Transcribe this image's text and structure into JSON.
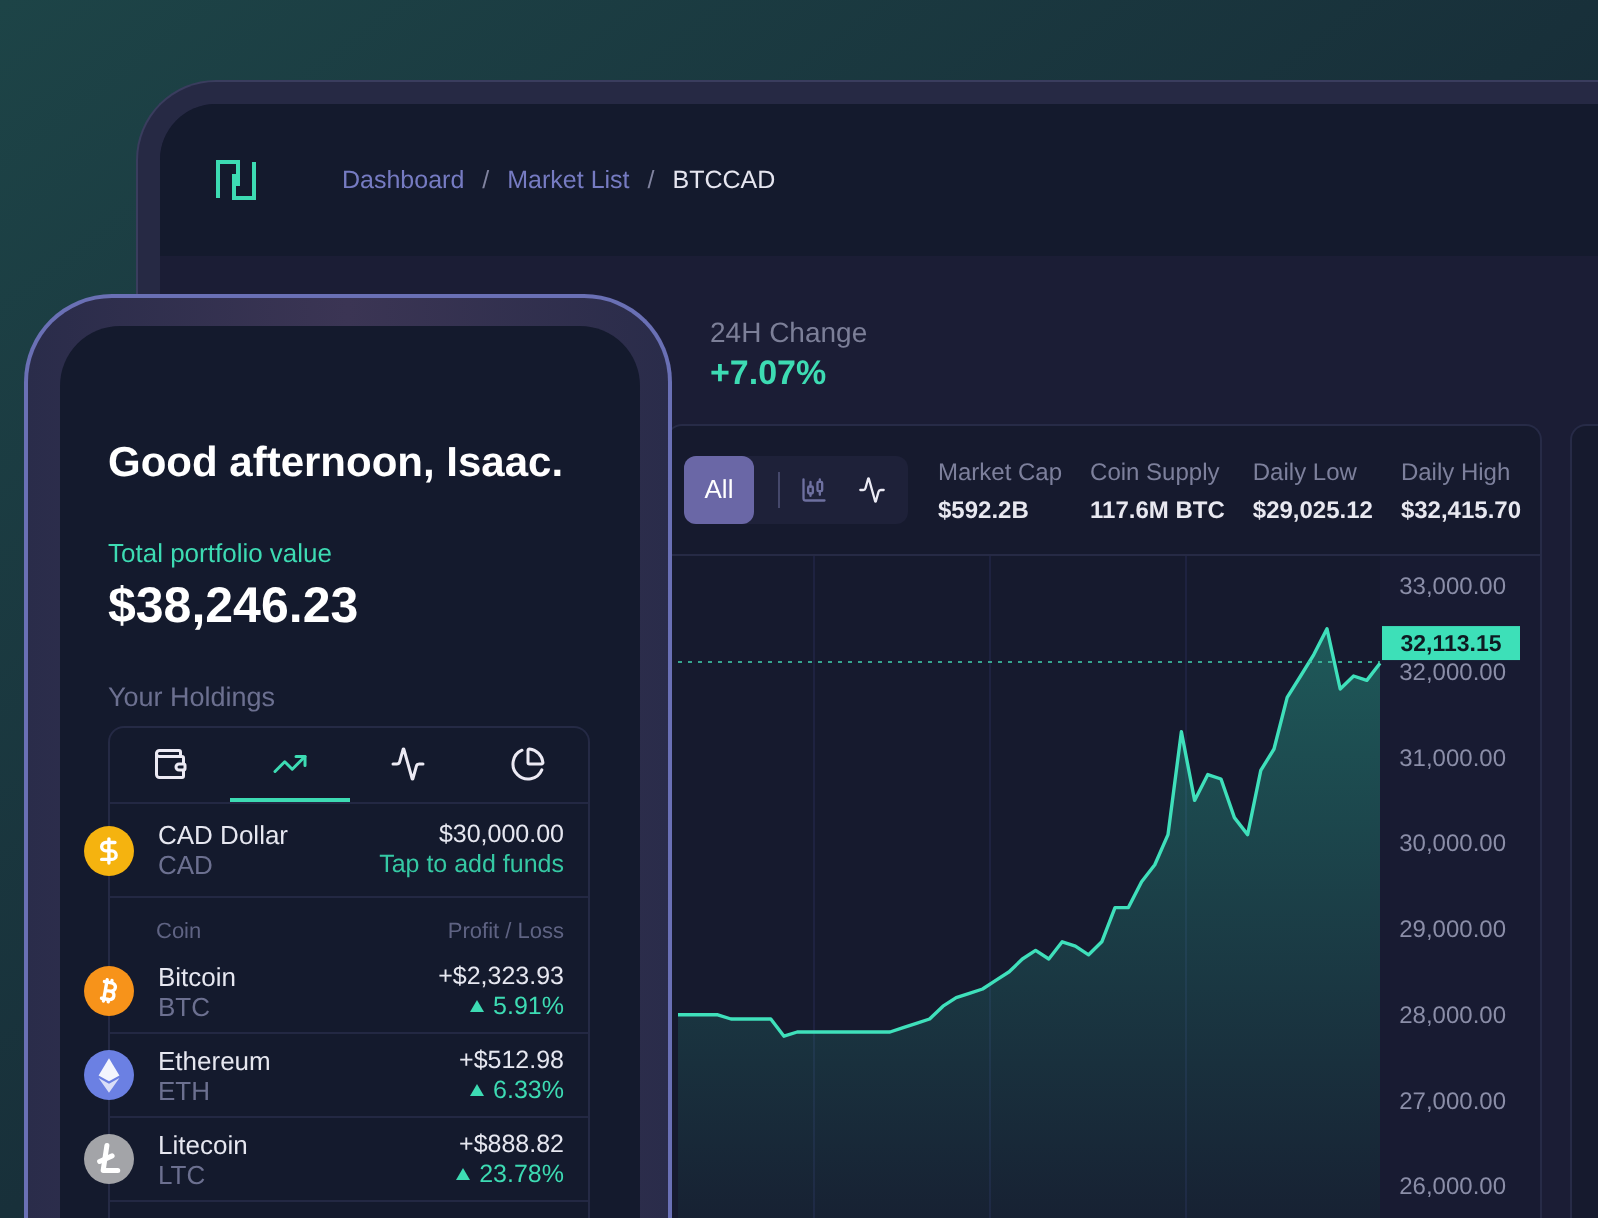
{
  "breadcrumb": {
    "items": [
      {
        "label": "Dashboard",
        "current": false
      },
      {
        "label": "Market List",
        "current": false
      },
      {
        "label": "BTCCAD",
        "current": true
      }
    ],
    "separators": [
      "/",
      "/"
    ]
  },
  "change_24h": {
    "label": "24H Change",
    "value": "+7.07%"
  },
  "chart_panel": {
    "ranges": [
      {
        "label": "All",
        "selected": true
      }
    ],
    "chart_types": [
      {
        "kind": "candles",
        "selected": false
      },
      {
        "kind": "line",
        "selected": true
      }
    ],
    "stats": [
      {
        "label": "Market Cap",
        "value": "$592.2B"
      },
      {
        "label": "Coin Supply",
        "value": "117.6M BTC"
      },
      {
        "label": "Daily Low",
        "value": "$29,025.12"
      },
      {
        "label": "Daily High",
        "value": "$32,415.70"
      }
    ],
    "chart_data": {
      "type": "area",
      "values": [
        28000,
        28000,
        28000,
        28000,
        27950,
        27950,
        27950,
        27950,
        27750,
        27800,
        27800,
        27800,
        27800,
        27800,
        27800,
        27800,
        27800,
        27850,
        27900,
        27950,
        28100,
        28200,
        28250,
        28300,
        28400,
        28500,
        28650,
        28750,
        28650,
        28850,
        28800,
        28700,
        28850,
        29250,
        29250,
        29550,
        29750,
        30100,
        31300,
        30500,
        30800,
        30750,
        30300,
        30100,
        30850,
        31100,
        31700,
        31950,
        32200,
        32500,
        31800,
        31950,
        31900,
        32100
      ],
      "ylim": [
        25630,
        33350
      ],
      "yticks": [
        {
          "value": 33000,
          "label": "33,000.00"
        },
        {
          "value": 32000,
          "label": "32,000.00"
        },
        {
          "value": 31000,
          "label": "31,000.00"
        },
        {
          "value": 30000,
          "label": "30,000.00"
        },
        {
          "value": 29000,
          "label": "29,000.00"
        },
        {
          "value": 28000,
          "label": "28,000.00"
        },
        {
          "value": 27000,
          "label": "27,000.00"
        },
        {
          "value": 26000,
          "label": "26,000.00"
        }
      ],
      "ref_lines": [
        {
          "axis": "y",
          "value": 32113.15,
          "label": "32,113.15"
        }
      ]
    }
  },
  "phone": {
    "greeting": "Good afternoon, Isaac.",
    "portfolio": {
      "label": "Total portfolio value",
      "value": "$38,246.23"
    },
    "holdings": {
      "title": "Your Holdings",
      "tabs": [
        {
          "kind": "wallet",
          "selected": false
        },
        {
          "kind": "trend",
          "selected": true
        },
        {
          "kind": "pulse",
          "selected": false
        },
        {
          "kind": "pie",
          "selected": false
        }
      ],
      "cash": {
        "name": "CAD Dollar",
        "code": "CAD",
        "amount": "$30,000.00",
        "action": "Tap to add funds",
        "kind": "dollar",
        "color": "#f5b30f"
      },
      "columns": [
        "Coin",
        "Profit / Loss"
      ],
      "coins": [
        {
          "name": "Bitcoin",
          "code": "BTC",
          "profit": "+$2,323.93",
          "change": "5.91%",
          "gain": true,
          "kind": "bitcoin",
          "color": "#f7931a"
        },
        {
          "name": "Ethereum",
          "code": "ETH",
          "profit": "+$512.98",
          "change": "6.33%",
          "gain": true,
          "kind": "ethereum",
          "color": "#6b80e3"
        },
        {
          "name": "Litecoin",
          "code": "LTC",
          "profit": "+$888.82",
          "change": "23.78%",
          "gain": true,
          "kind": "litecoin",
          "color": "#a3a4a8"
        }
      ]
    }
  }
}
